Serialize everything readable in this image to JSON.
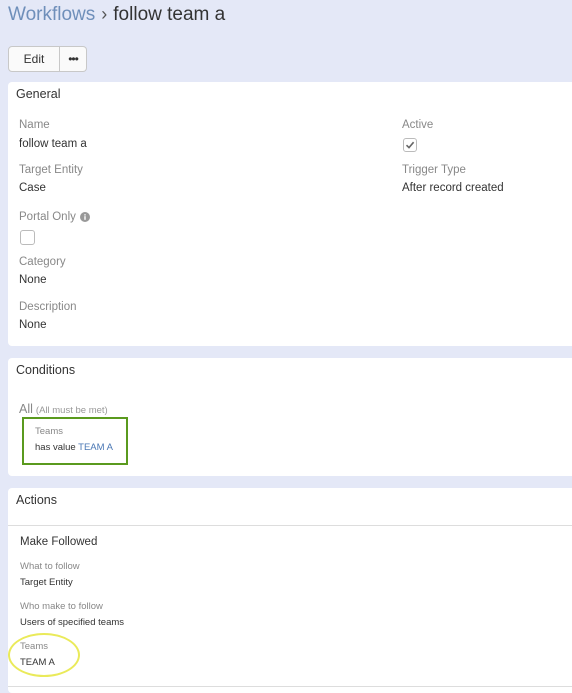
{
  "header": {
    "breadcrumb_link": "Workflows",
    "separator": "›",
    "title": "follow team a"
  },
  "toolbar": {
    "edit_label": "Edit",
    "more_label": "•••"
  },
  "general": {
    "title": "General",
    "name_label": "Name",
    "name_value": "follow team a",
    "active_label": "Active",
    "active_checked": true,
    "target_entity_label": "Target Entity",
    "target_entity_value": "Case",
    "trigger_type_label": "Trigger Type",
    "trigger_type_value": "After record created",
    "portal_only_label": "Portal Only",
    "portal_only_checked": false,
    "category_label": "Category",
    "category_value": "None",
    "description_label": "Description",
    "description_value": "None"
  },
  "conditions": {
    "title": "Conditions",
    "group_label": "All",
    "group_hint": "(All must be met)",
    "item_field": "Teams",
    "item_operator": "has value",
    "item_value": "TEAM A",
    "highlight_color": "#5a9a1e"
  },
  "actions": {
    "title": "Actions",
    "action_title": "Make Followed",
    "what_label": "What to follow",
    "what_value": "Target Entity",
    "who_label": "Who make to follow",
    "who_value": "Users of specified teams",
    "teams_label": "Teams",
    "teams_value": "TEAM A",
    "highlight_color": "#eaea5a"
  }
}
